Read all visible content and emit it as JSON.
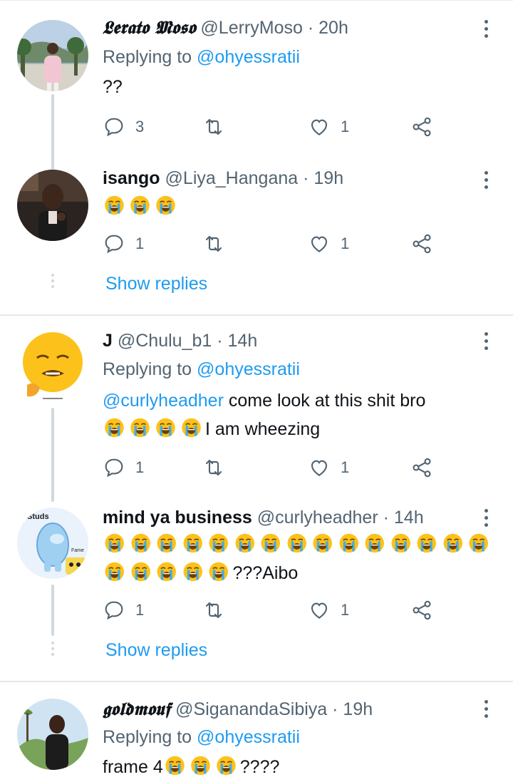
{
  "colors": {
    "link": "#1d9bf0",
    "secondary": "#536471",
    "thread_line": "#cfd9de"
  },
  "tweets": [
    {
      "name": "𝕷𝖊𝖗𝖆𝖙𝖔 𝕸𝖔𝖘𝖔",
      "handle": "@LerryMoso",
      "time": "· 20h",
      "replying_prefix": "Replying to",
      "replying_to": "@ohyessratii",
      "text": "??",
      "replies": "3",
      "retweets": "",
      "likes": "1"
    },
    {
      "name": "isango",
      "handle": "@Liya_Hangana",
      "time": "· 19h",
      "text_emoji": "😭😭😭",
      "replies": "1",
      "retweets": "",
      "likes": "1",
      "show_replies": "Show replies"
    },
    {
      "name": "J",
      "handle": "@Chulu_b1",
      "time": "· 14h",
      "replying_prefix": "Replying to",
      "replying_to": "@ohyessratii",
      "mention": "@curlyheadher",
      "text_line1": " come look at this shit bro",
      "text_line2": "I am wheezing",
      "replies": "1",
      "retweets": "",
      "likes": "1"
    },
    {
      "name": "mind ya business",
      "handle": "@curlyheadher",
      "time": "· 14h",
      "text_tail": "???Aibo",
      "replies": "1",
      "retweets": "",
      "likes": "1",
      "show_replies": "Show replies"
    },
    {
      "name": "𝖌𝖔𝖑𝖉𝖒𝖔𝖚𝖋",
      "handle": "@SiganandaSibiya",
      "time": "· 19h",
      "replying_prefix": "Replying to",
      "replying_to": "@ohyessratii",
      "text_head": "frame 4",
      "text_tail": "????"
    }
  ],
  "avatar_labels": {
    "studs": "Studs",
    "fame": "Fame"
  },
  "icons": [
    "reply-icon",
    "retweet-icon",
    "like-icon",
    "share-icon",
    "more-icon",
    "crying-emoji"
  ]
}
